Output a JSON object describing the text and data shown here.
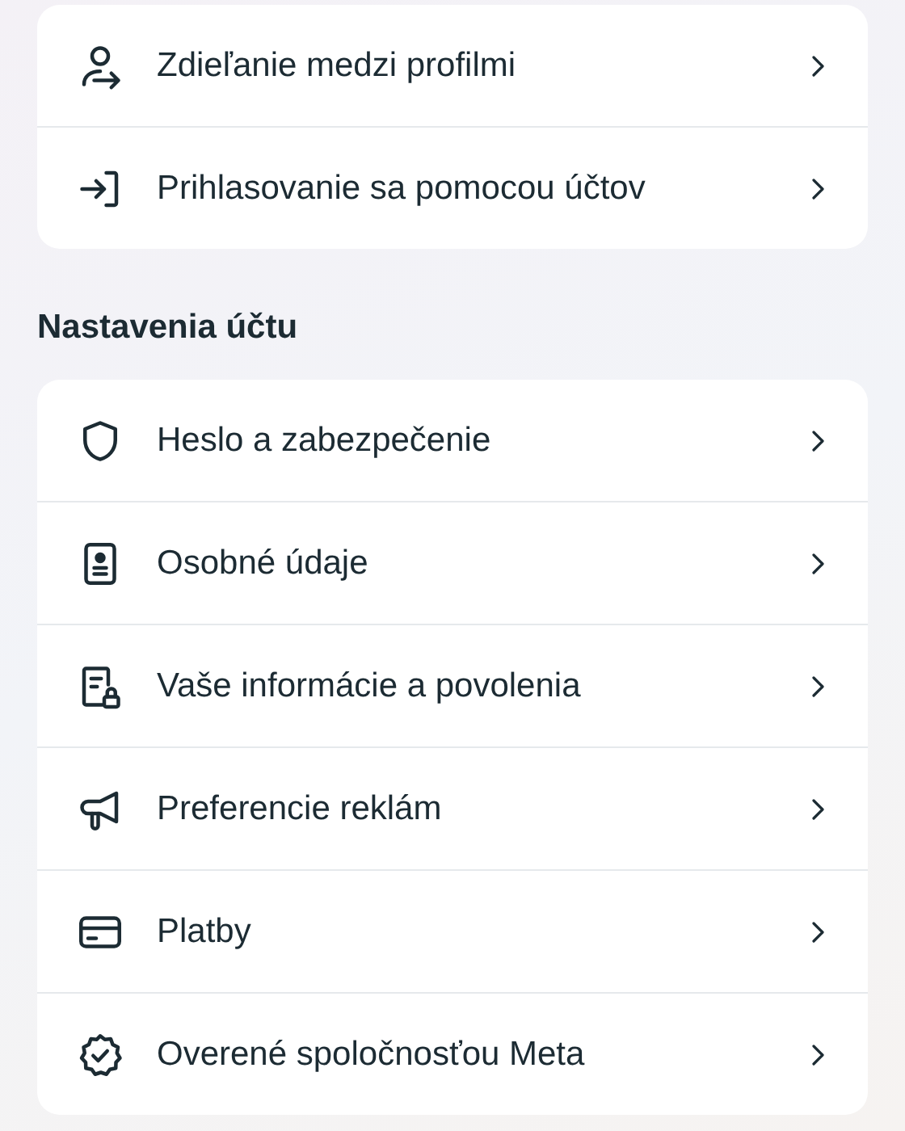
{
  "sections": [
    {
      "items": [
        {
          "label": "Zdieľanie medzi profilmi"
        },
        {
          "label": "Prihlasovanie sa pomocou účtov"
        }
      ]
    },
    {
      "heading": "Nastavenia účtu",
      "items": [
        {
          "label": "Heslo a zabezpečenie"
        },
        {
          "label": "Osobné údaje"
        },
        {
          "label": "Vaše informácie a povolenia"
        },
        {
          "label": "Preferencie reklám"
        },
        {
          "label": "Platby"
        },
        {
          "label": "Overené spoločnosťou Meta"
        }
      ]
    }
  ]
}
